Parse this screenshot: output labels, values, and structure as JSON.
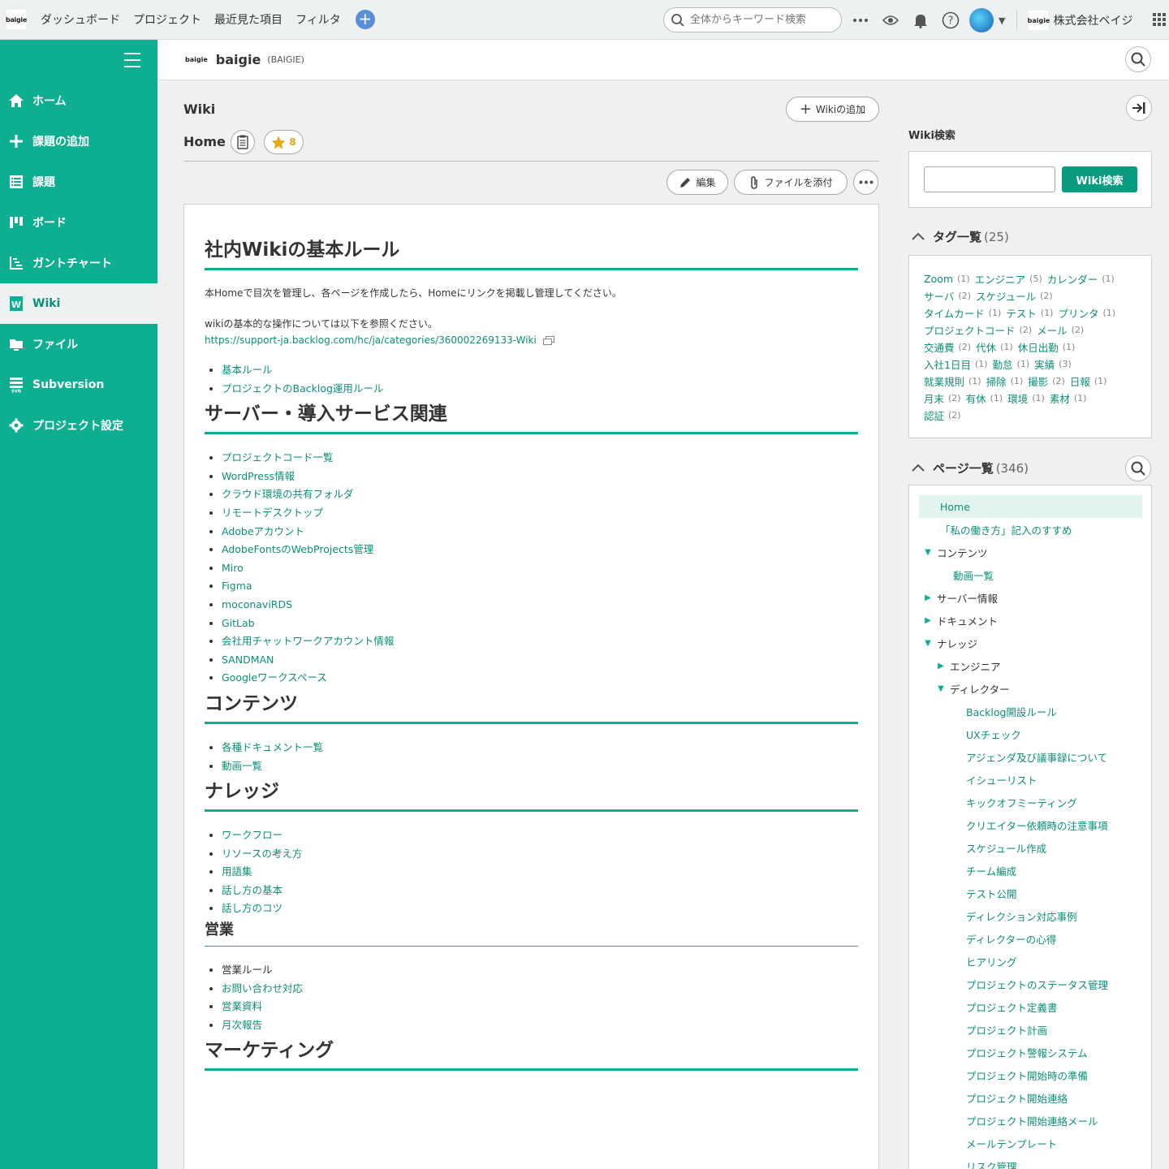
{
  "topbar": {
    "logo": "baigie",
    "nav": [
      "ダッシュボード",
      "プロジェクト",
      "最近見た項目",
      "フィルタ"
    ],
    "search_placeholder": "全体からキーワード検索",
    "company_logo": "baigie",
    "company_name": "株式会社ベイジ"
  },
  "sidebar": {
    "items": [
      {
        "label": "ホーム",
        "icon": "home-icon"
      },
      {
        "label": "課題の追加",
        "icon": "plus-icon"
      },
      {
        "label": "課題",
        "icon": "list-icon"
      },
      {
        "label": "ボード",
        "icon": "board-icon"
      },
      {
        "label": "ガントチャート",
        "icon": "gantt-icon"
      },
      {
        "label": "Wiki",
        "icon": "wiki-icon",
        "active": true
      },
      {
        "label": "ファイル",
        "icon": "file-icon"
      },
      {
        "label": "Subversion",
        "icon": "svn-icon"
      },
      {
        "label": "プロジェクト設定",
        "icon": "gear-icon"
      }
    ]
  },
  "project": {
    "logo": "baigie",
    "name": "baigie",
    "key": "(BAIGIE)"
  },
  "wiki": {
    "title": "Wiki",
    "add_label": "Wikiの追加",
    "page_title": "Home",
    "star_count": "8",
    "edit_label": "編集",
    "attach_label": "ファイルを添付"
  },
  "content": {
    "h1": "社内Wikiの基本ルール",
    "intro1": "本Homeで目次を管理し、各ページを作成したら、Homeにリンクを掲載し管理してください。",
    "intro2": "wikiの基本的な操作については以下を参照ください。",
    "link": "https://support-ja.backlog.com/hc/ja/categories/360002269133-Wiki",
    "basics": [
      "基本ルール",
      "プロジェクトのBacklog運用ルール"
    ],
    "server_h": "サーバー・導入サービス関連",
    "server_items": [
      "プロジェクトコード一覧",
      "WordPress情報",
      "クラウド環境の共有フォルダ",
      "リモートデスクトップ",
      "Adobeアカウント",
      "AdobeFontsのWebProjects管理",
      "Miro",
      "Figma",
      "moconaviRDS",
      "GitLab",
      "会社用チャットワークアカウント情報",
      "SANDMAN",
      "Googleワークスペース"
    ],
    "contents_h": "コンテンツ",
    "contents_items": [
      "各種ドキュメント一覧",
      "動画一覧"
    ],
    "knowledge_h": "ナレッジ",
    "knowledge_items": [
      {
        "label": "ワークフロー",
        "link": true
      },
      {
        "label": "リソースの考え方",
        "link": true
      },
      {
        "label": "用語集",
        "link": true
      },
      {
        "label": "話し方の基本",
        "link": true
      },
      {
        "label": "話し方のコツ",
        "link": true
      }
    ],
    "sales_h": "営業",
    "sales_items": [
      {
        "label": "営業ルール",
        "link": false
      },
      {
        "label": "お問い合わせ対応",
        "link": true
      },
      {
        "label": "営業資料",
        "link": true
      },
      {
        "label": "月次報告",
        "link": true
      }
    ],
    "marketing_h": "マーケティング"
  },
  "right": {
    "search_label": "Wiki検索",
    "search_button": "Wiki検索",
    "tags_label": "タグ一覧",
    "tags_count": "(25)",
    "tag_lines": [
      [
        {
          "t": "Zoom",
          "c": "(1)"
        },
        {
          "t": "エンジニア",
          "c": "(5)"
        },
        {
          "t": "カレンダー",
          "c": "(1)"
        }
      ],
      [
        {
          "t": "サーバ",
          "c": "(2)"
        },
        {
          "t": "スケジュール",
          "c": "(2)"
        }
      ],
      [
        {
          "t": "タイムカード",
          "c": "(1)"
        },
        {
          "t": "テスト",
          "c": "(1)"
        },
        {
          "t": "プリンタ",
          "c": "(1)"
        }
      ],
      [
        {
          "t": "プロジェクトコード",
          "c": "(2)"
        },
        {
          "t": "メール",
          "c": "(2)"
        }
      ],
      [
        {
          "t": "交通費",
          "c": "(2)"
        },
        {
          "t": "代休",
          "c": "(1)"
        },
        {
          "t": "休日出勤",
          "c": "(1)"
        }
      ],
      [
        {
          "t": "入社1日目",
          "c": "(1)"
        },
        {
          "t": "勤怠",
          "c": "(1)"
        },
        {
          "t": "実績",
          "c": "(3)"
        }
      ],
      [
        {
          "t": "就業規則",
          "c": "(1)"
        },
        {
          "t": "掃除",
          "c": "(1)"
        },
        {
          "t": "撮影",
          "c": "(2)"
        },
        {
          "t": "日報",
          "c": "(1)"
        }
      ],
      [
        {
          "t": "月末",
          "c": "(2)"
        },
        {
          "t": "有休",
          "c": "(1)"
        },
        {
          "t": "環境",
          "c": "(1)"
        },
        {
          "t": "素材",
          "c": "(1)"
        }
      ],
      [
        {
          "t": "認証",
          "c": "(2)"
        }
      ]
    ],
    "pages_label": "ページ一覧",
    "pages_count": "(346)",
    "tree": [
      {
        "label": "Home",
        "level": 0,
        "tri": "",
        "link": true,
        "sel": true
      },
      {
        "label": "「私の働き方」記入のすすめ",
        "level": 0,
        "tri": "",
        "link": true
      },
      {
        "label": "コンテンツ",
        "level": 0,
        "tri": "▼",
        "link": false
      },
      {
        "label": "動画一覧",
        "level": 1,
        "tri": "",
        "link": true
      },
      {
        "label": "サーバー情報",
        "level": 0,
        "tri": "▶",
        "link": false
      },
      {
        "label": "ドキュメント",
        "level": 0,
        "tri": "▶",
        "link": false
      },
      {
        "label": "ナレッジ",
        "level": 0,
        "tri": "▼",
        "link": false
      },
      {
        "label": "エンジニア",
        "level": 1,
        "tri": "▶",
        "link": false
      },
      {
        "label": "ディレクター",
        "level": 1,
        "tri": "▼",
        "link": false
      },
      {
        "label": "Backlog開設ルール",
        "level": 2,
        "tri": "",
        "link": true
      },
      {
        "label": "UXチェック",
        "level": 2,
        "tri": "",
        "link": true
      },
      {
        "label": "アジェンダ及び議事録について",
        "level": 2,
        "tri": "",
        "link": true
      },
      {
        "label": "イシューリスト",
        "level": 2,
        "tri": "",
        "link": true
      },
      {
        "label": "キックオフミーティング",
        "level": 2,
        "tri": "",
        "link": true
      },
      {
        "label": "クリエイター依頼時の注意事項",
        "level": 2,
        "tri": "",
        "link": true
      },
      {
        "label": "スケジュール作成",
        "level": 2,
        "tri": "",
        "link": true
      },
      {
        "label": "チーム編成",
        "level": 2,
        "tri": "",
        "link": true
      },
      {
        "label": "テスト公開",
        "level": 2,
        "tri": "",
        "link": true
      },
      {
        "label": "ディレクション対応事例",
        "level": 2,
        "tri": "",
        "link": true
      },
      {
        "label": "ディレクターの心得",
        "level": 2,
        "tri": "",
        "link": true
      },
      {
        "label": "ヒアリング",
        "level": 2,
        "tri": "",
        "link": true
      },
      {
        "label": "プロジェクトのステータス管理",
        "level": 2,
        "tri": "",
        "link": true
      },
      {
        "label": "プロジェクト定義書",
        "level": 2,
        "tri": "",
        "link": true
      },
      {
        "label": "プロジェクト計画",
        "level": 2,
        "tri": "",
        "link": true
      },
      {
        "label": "プロジェクト警報システム",
        "level": 2,
        "tri": "",
        "link": true
      },
      {
        "label": "プロジェクト開始時の準備",
        "level": 2,
        "tri": "",
        "link": true
      },
      {
        "label": "プロジェクト開始連絡",
        "level": 2,
        "tri": "",
        "link": true
      },
      {
        "label": "プロジェクト開始連絡メール",
        "level": 2,
        "tri": "",
        "link": true
      },
      {
        "label": "メールテンプレート",
        "level": 2,
        "tri": "",
        "link": true
      },
      {
        "label": "リスク管理",
        "level": 2,
        "tri": "",
        "link": true
      }
    ]
  }
}
